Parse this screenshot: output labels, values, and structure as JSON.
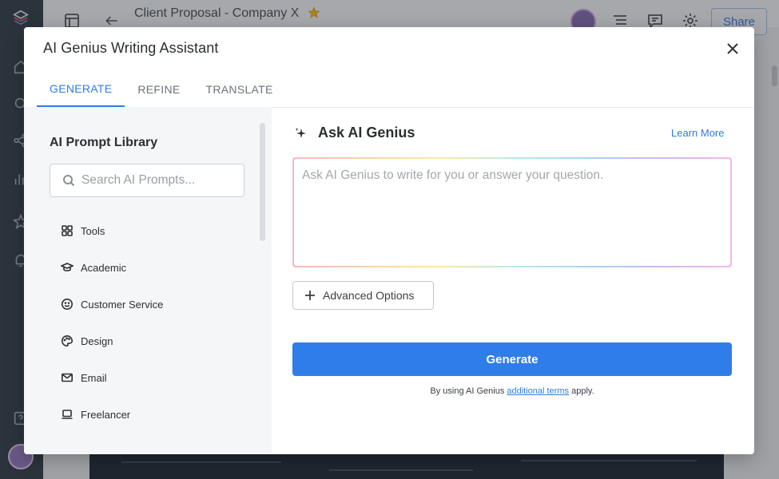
{
  "background": {
    "document_title": "Client Proposal - Company X",
    "share_label": "Share"
  },
  "modal": {
    "title": "AI Genius Writing Assistant",
    "tabs": [
      {
        "label": "GENERATE",
        "active": true
      },
      {
        "label": "REFINE",
        "active": false
      },
      {
        "label": "TRANSLATE",
        "active": false
      }
    ]
  },
  "library": {
    "title": "AI Prompt Library",
    "search_placeholder": "Search AI Prompts...",
    "categories": [
      {
        "label": "Tools",
        "icon": "grid-icon"
      },
      {
        "label": "Academic",
        "icon": "graduation-cap-icon"
      },
      {
        "label": "Customer Service",
        "icon": "smiley-icon"
      },
      {
        "label": "Design",
        "icon": "palette-icon"
      },
      {
        "label": "Email",
        "icon": "mail-icon"
      },
      {
        "label": "Freelancer",
        "icon": "laptop-icon"
      }
    ]
  },
  "ask": {
    "title": "Ask AI Genius",
    "learn_more": "Learn More",
    "prompt_placeholder": "Ask AI Genius to write for you or answer your question.",
    "advanced_options_label": "Advanced Options",
    "generate_label": "Generate",
    "terms_prefix": "By using AI Genius ",
    "terms_link": "additional terms",
    "terms_suffix": " apply."
  },
  "colors": {
    "accent": "#2f7de8",
    "sidebar": "#1f2a35"
  }
}
